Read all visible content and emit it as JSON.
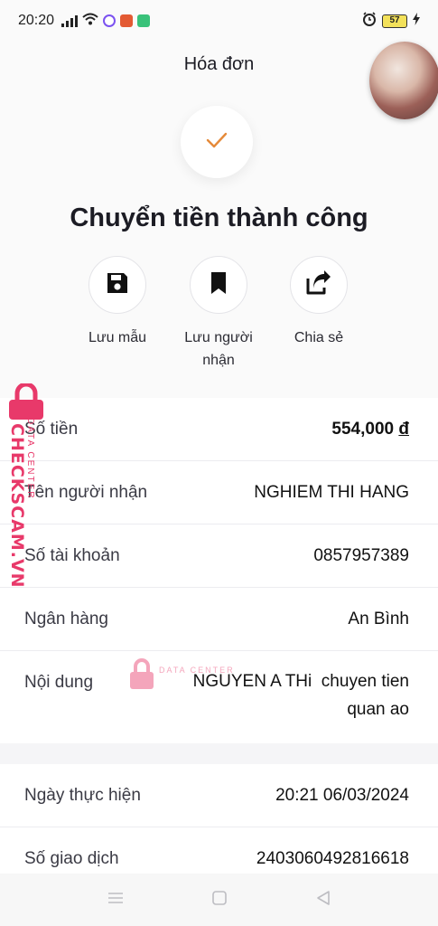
{
  "status_bar": {
    "time": "20:20",
    "battery": "57",
    "icons": [
      "signal-icon",
      "wifi-icon",
      "messenger-icon",
      "app-icon",
      "app-icon",
      "alarm-icon",
      "battery-icon",
      "charging-icon"
    ]
  },
  "header": {
    "title": "Hóa đơn"
  },
  "success": {
    "icon": "checkmark-icon",
    "title": "Chuyển tiền thành công",
    "accent_color": "#e58a3a"
  },
  "actions": [
    {
      "label": "Lưu mẫu",
      "icon": "save-icon"
    },
    {
      "label": "Lưu người nhận",
      "icon": "bookmark-icon"
    },
    {
      "label": "Chia sẻ",
      "icon": "share-icon"
    }
  ],
  "details": {
    "amount": {
      "label": "Số tiền",
      "value": "554,000",
      "currency": "đ"
    },
    "recipient": {
      "label": "Tên người nhận",
      "value": "NGHIEM THI HANG"
    },
    "account": {
      "label": "Số tài khoản",
      "value": "0857957389"
    },
    "bank": {
      "label": "Ngân hàng",
      "value": "An Bình"
    },
    "content": {
      "label": "Nội dung",
      "value_line1": "NGUYEN A THi  chuyen tien",
      "value_line2": "quan ao"
    }
  },
  "transaction": {
    "date": {
      "label": "Ngày thực hiện",
      "value": "20:21 06/03/2024"
    },
    "id": {
      "label": "Số giao dịch",
      "value": "2403060492816618"
    }
  },
  "watermark": {
    "brand": "CHECKSCAM.VN",
    "sub": "DATA CENTER",
    "color": "#e8396a"
  }
}
